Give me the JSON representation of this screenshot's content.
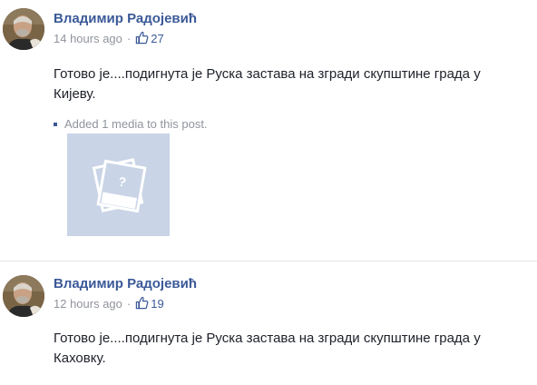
{
  "posts": [
    {
      "author": "Владимир Радојевић",
      "time": "14 hours ago",
      "separator": "·",
      "likes": "27",
      "text": "Готово је....подигнута је Руска застава на згради скупштине града у Кијеву.",
      "media_note": "Added 1 media to this post."
    },
    {
      "author": "Владимир Радојевић",
      "time": "12 hours ago",
      "separator": "·",
      "likes": "19",
      "text": "Готово је....подигнута је Руска застава на згради скупштине града у Каховку."
    }
  ],
  "colors": {
    "author_link": "#3b5998",
    "meta_gray": "#90949c",
    "body_text": "#1d2129",
    "media_placeholder_bg": "#c9d4e6"
  },
  "icons": {
    "like": "thumbs-up-icon",
    "media_placeholder": "image-placeholder-icon",
    "avatar": "user-avatar-photo"
  }
}
